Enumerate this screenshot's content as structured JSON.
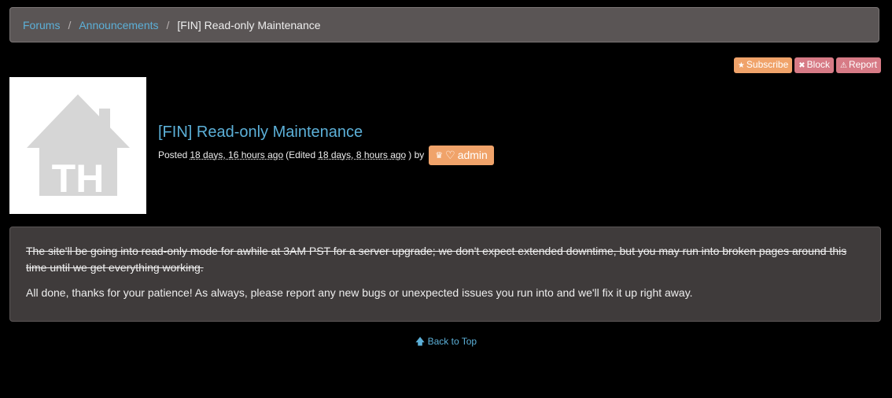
{
  "breadcrumb": {
    "items": [
      "Forums",
      "Announcements"
    ],
    "separator": "/",
    "current": "[FIN] Read-only Maintenance"
  },
  "actions": {
    "subscribe": "Subscribe",
    "block": "Block",
    "report": "Report"
  },
  "post": {
    "title": "[FIN] Read-only Maintenance",
    "posted_prefix": "Posted",
    "posted_time": "18 days, 16 hours ago",
    "edited_prefix": "(Edited",
    "edited_time": "18 days, 8 hours ago",
    "edited_suffix": ") by",
    "author": "admin",
    "body_struck": "The site'll be going into read-only mode for awhile at 3AM PST for a server upgrade; we don't expect extended downtime, but you may run into broken pages around this time until we get everything working.",
    "body": "All done, thanks for your patience! As always, please report any new bugs or unexpected issues you run into and we'll fix it up right away."
  },
  "footer": {
    "back_to_top": "Back to Top"
  },
  "avatar": {
    "letters": "TH"
  },
  "colors": {
    "link": "#5cb0d8",
    "orange": "#f0a36a",
    "pink": "#d77b86"
  }
}
